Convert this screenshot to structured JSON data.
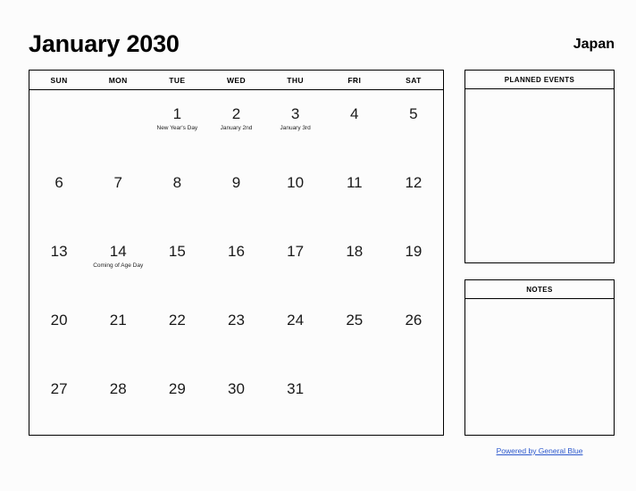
{
  "header": {
    "month_title": "January 2030",
    "country": "Japan"
  },
  "calendar": {
    "weekday_headers": [
      "SUN",
      "MON",
      "TUE",
      "WED",
      "THU",
      "FRI",
      "SAT"
    ],
    "weeks": [
      [
        {
          "day": "",
          "event": ""
        },
        {
          "day": "",
          "event": ""
        },
        {
          "day": "1",
          "event": "New Year's Day"
        },
        {
          "day": "2",
          "event": "January 2nd"
        },
        {
          "day": "3",
          "event": "January 3rd"
        },
        {
          "day": "4",
          "event": ""
        },
        {
          "day": "5",
          "event": ""
        }
      ],
      [
        {
          "day": "6",
          "event": ""
        },
        {
          "day": "7",
          "event": ""
        },
        {
          "day": "8",
          "event": ""
        },
        {
          "day": "9",
          "event": ""
        },
        {
          "day": "10",
          "event": ""
        },
        {
          "day": "11",
          "event": ""
        },
        {
          "day": "12",
          "event": ""
        }
      ],
      [
        {
          "day": "13",
          "event": ""
        },
        {
          "day": "14",
          "event": "Coming of Age Day"
        },
        {
          "day": "15",
          "event": ""
        },
        {
          "day": "16",
          "event": ""
        },
        {
          "day": "17",
          "event": ""
        },
        {
          "day": "18",
          "event": ""
        },
        {
          "day": "19",
          "event": ""
        }
      ],
      [
        {
          "day": "20",
          "event": ""
        },
        {
          "day": "21",
          "event": ""
        },
        {
          "day": "22",
          "event": ""
        },
        {
          "day": "23",
          "event": ""
        },
        {
          "day": "24",
          "event": ""
        },
        {
          "day": "25",
          "event": ""
        },
        {
          "day": "26",
          "event": ""
        }
      ],
      [
        {
          "day": "27",
          "event": ""
        },
        {
          "day": "28",
          "event": ""
        },
        {
          "day": "29",
          "event": ""
        },
        {
          "day": "30",
          "event": ""
        },
        {
          "day": "31",
          "event": ""
        },
        {
          "day": "",
          "event": ""
        },
        {
          "day": "",
          "event": ""
        }
      ]
    ]
  },
  "panels": {
    "planned_events": {
      "title": "PLANNED EVENTS",
      "content": ""
    },
    "notes": {
      "title": "NOTES",
      "content": ""
    }
  },
  "footer": {
    "link_text": "Powered by General Blue"
  },
  "colors": {
    "link": "#2b57cc",
    "border": "#000000",
    "background": "#fcfcfc",
    "text": "#000000"
  }
}
